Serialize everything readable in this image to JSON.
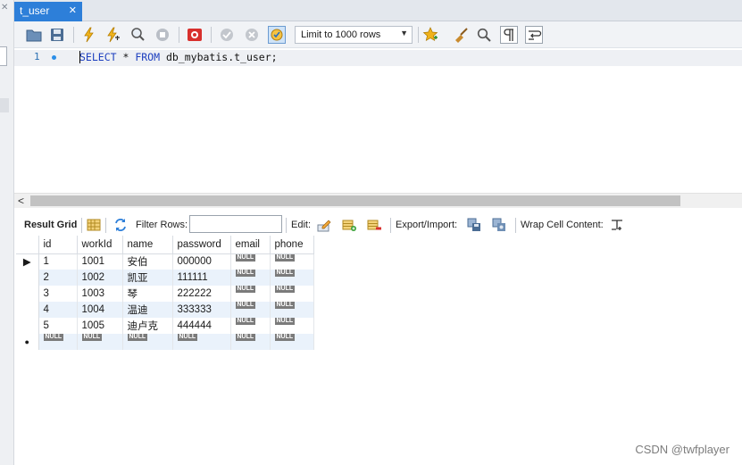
{
  "tab": {
    "title": "t_user",
    "close": "✕"
  },
  "left_strip": {
    "close": "✕"
  },
  "toolbar": {
    "limit_select": {
      "value": "Limit to 1000 rows"
    }
  },
  "editor": {
    "line_number": "1",
    "keyword_select": "SELECT",
    "middle": " * ",
    "keyword_from": "FROM",
    "rest": " db_mybatis.t_user;"
  },
  "result_toolbar": {
    "result_grid_label": "Result Grid",
    "filter_label": "Filter Rows:",
    "filter_value": "",
    "edit_label": "Edit:",
    "export_label": "Export/Import:",
    "wrap_label": "Wrap Cell Content:"
  },
  "grid": {
    "columns": [
      "id",
      "workId",
      "name",
      "password",
      "email",
      "phone"
    ],
    "rows": [
      [
        "1",
        "1001",
        "安伯",
        "000000",
        "NULL",
        "NULL"
      ],
      [
        "2",
        "1002",
        "凯亚",
        "111111",
        "NULL",
        "NULL"
      ],
      [
        "3",
        "1003",
        "琴",
        "222222",
        "NULL",
        "NULL"
      ],
      [
        "4",
        "1004",
        "温迪",
        "333333",
        "NULL",
        "NULL"
      ],
      [
        "5",
        "1005",
        "迪卢克",
        "444444",
        "NULL",
        "NULL"
      ]
    ],
    "new_row": [
      "NULL",
      "NULL",
      "NULL",
      "NULL",
      "NULL",
      "NULL"
    ],
    "null_label": "NULL"
  },
  "watermark": "CSDN @twfplayer",
  "colors": {
    "tab_active": "#2d7fd9",
    "row_alt": "#eaf2fb",
    "keyword": "#1d3fbf"
  }
}
